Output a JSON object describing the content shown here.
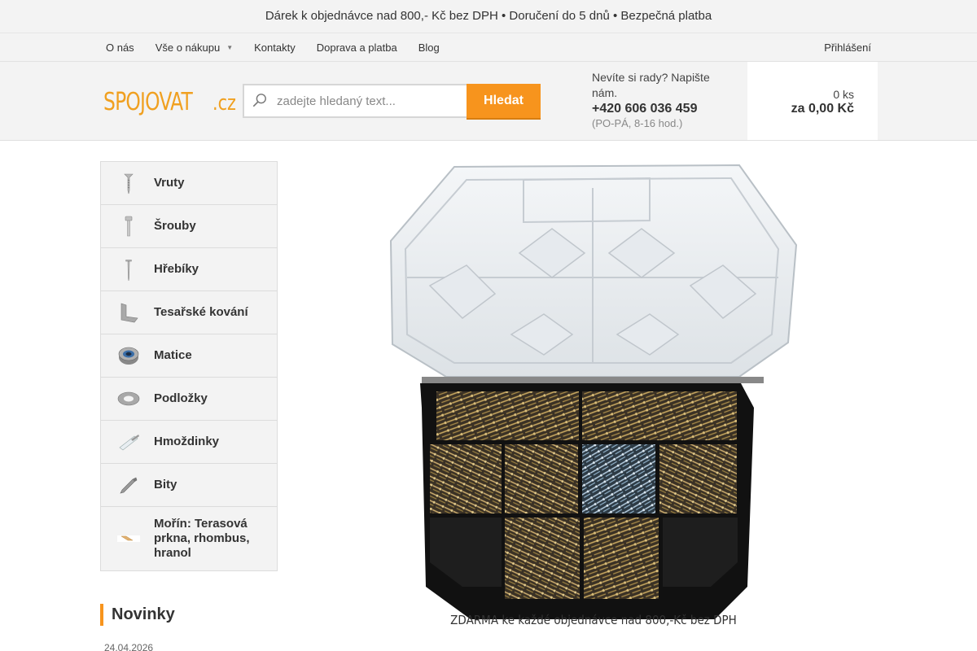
{
  "promo": {
    "text1": "Dárek k objednávce nad 800,- Kč bez DPH • ",
    "text2": " Doručení do 5 dnů • ",
    "text3": " Bezpečná platba",
    "glyph": ""
  },
  "topnav": {
    "items": [
      {
        "label": "O nás"
      },
      {
        "label": "Vše o nákupu"
      },
      {
        "label": "Kontakty"
      },
      {
        "label": "Doprava a platba"
      },
      {
        "label": "Blog"
      }
    ],
    "login_icon": "",
    "login_label": "Přihlášení"
  },
  "header": {
    "logo_word": "SPOJOVAT",
    "logo_tld": ".cz",
    "search_placeholder": "zadejte hledaný text...",
    "search_button": "Hledat",
    "contact_question": "Nevíte si rady? Napište nám.",
    "contact_phone": "+420 606 036 459",
    "contact_hours": "(PO-PÁ, 8-16 hod.)",
    "phone_icon": "",
    "cart_icon": "",
    "cart_qty": "0 ks",
    "cart_total": "za 0,00 Kč"
  },
  "sidebar": {
    "categories": [
      {
        "label": "Vruty",
        "icon": "wood-screw-icon"
      },
      {
        "label": "Šrouby",
        "icon": "bolt-icon"
      },
      {
        "label": "Hřebíky",
        "icon": "nail-icon"
      },
      {
        "label": "Tesařské kování",
        "icon": "angle-bracket-icon"
      },
      {
        "label": "Matice",
        "icon": "nut-icon"
      },
      {
        "label": "Podložky",
        "icon": "washer-icon"
      },
      {
        "label": "Hmoždinky",
        "icon": "wall-plug-icon"
      },
      {
        "label": "Bity",
        "icon": "bit-icon"
      },
      {
        "label": "Mořín: Terasová prkna, rhombus, hranol",
        "icon": "wood-plank-icon"
      }
    ]
  },
  "news": {
    "heading": "Novinky",
    "date_icon": "",
    "date": "24.04.2026"
  },
  "banner": {
    "caption": "ZDARMA ke každé objednávce nad 800,-Kč bez DPH"
  },
  "colors": {
    "accent": "#f7941d",
    "logo": "#f0a020",
    "cart": "#3bb54a",
    "background": "#f3f3f3"
  }
}
